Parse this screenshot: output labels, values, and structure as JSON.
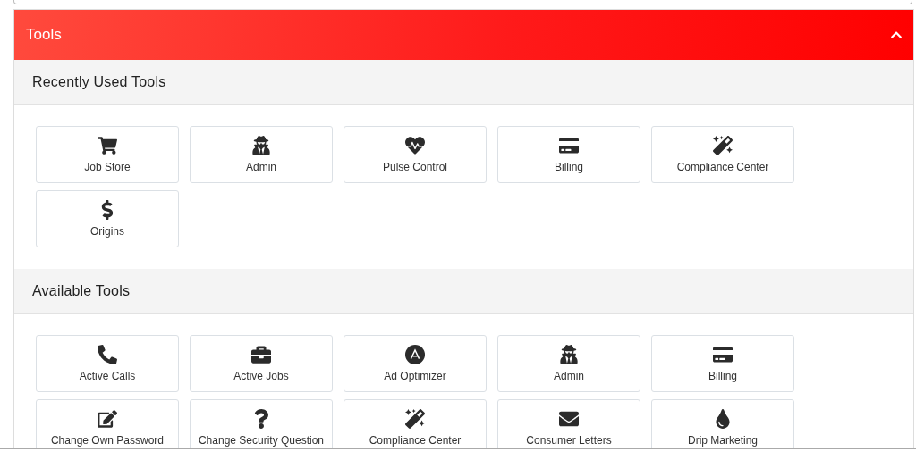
{
  "panel": {
    "title": "Tools",
    "expanded": true
  },
  "sections": [
    {
      "title": "Recently Used Tools",
      "tools": [
        {
          "label": "Job Store",
          "kind": "cart"
        },
        {
          "label": "Admin",
          "kind": "spy"
        },
        {
          "label": "Pulse Control",
          "kind": "heartbeat"
        },
        {
          "label": "Billing",
          "kind": "card"
        },
        {
          "label": "Compliance Center",
          "kind": "wand"
        },
        {
          "label": "Origins",
          "kind": "dollar"
        }
      ]
    },
    {
      "title": "Available Tools",
      "tools": [
        {
          "label": "Active Calls",
          "kind": "phone"
        },
        {
          "label": "Active Jobs",
          "kind": "briefcase"
        },
        {
          "label": "Ad Optimizer",
          "kind": "circle-a"
        },
        {
          "label": "Admin",
          "kind": "spy"
        },
        {
          "label": "Billing",
          "kind": "card"
        },
        {
          "label": "Change Own Password",
          "kind": "edit"
        },
        {
          "label": "Change Security Question",
          "kind": "question"
        },
        {
          "label": "Compliance Center",
          "kind": "wand"
        },
        {
          "label": "Consumer Letters",
          "kind": "envelope"
        },
        {
          "label": "Drip Marketing",
          "kind": "drop"
        }
      ]
    }
  ]
}
